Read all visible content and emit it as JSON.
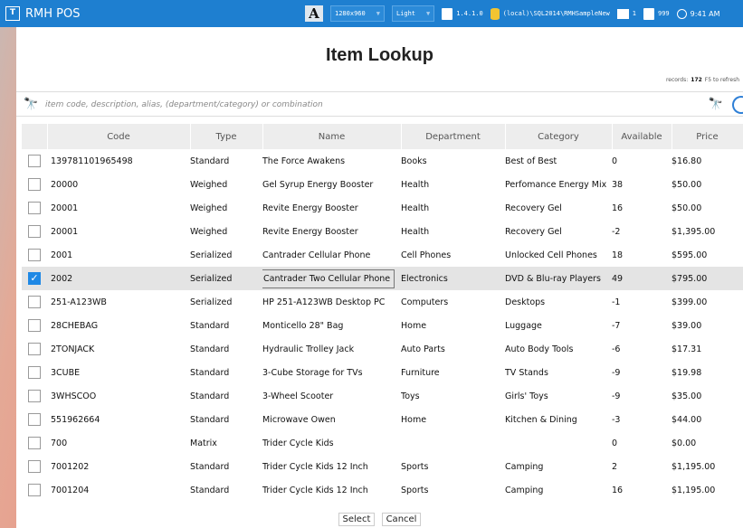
{
  "topbar": {
    "title": "RMH POS",
    "resolution": "1280x960",
    "theme": "Light",
    "version": "1.4.1.0",
    "database": "(local)\\SQL2014\\RMHSampleNew",
    "register": "1",
    "user": "999",
    "time": "9:41 AM",
    "icons": [
      "app-logo-icon",
      "font-size-icon",
      "version-icon",
      "database-icon",
      "register-icon",
      "user-icon",
      "clock-icon"
    ]
  },
  "page": {
    "title": "Item Lookup",
    "records_label": "records:",
    "records_count": "172",
    "refresh_hint": "F5 to refresh"
  },
  "search": {
    "placeholder": "item code, description, alias, (department/category) or combination",
    "value": ""
  },
  "table": {
    "columns": [
      "Code",
      "Type",
      "Name",
      "Department",
      "Category",
      "Available",
      "Price"
    ],
    "rows": [
      {
        "checked": false,
        "code": "139781101965498",
        "type": "Standard",
        "name": "The Force Awakens",
        "department": "Books",
        "category": "Best of Best",
        "available": "0",
        "price": "$16.80"
      },
      {
        "checked": false,
        "code": "20000",
        "type": "Weighed",
        "name": "Gel Syrup Energy Booster",
        "department": "Health",
        "category": "Perfomance Energy Mix",
        "available": "38",
        "price": "$50.00"
      },
      {
        "checked": false,
        "code": "20001",
        "type": "Weighed",
        "name": "Revite Energy Booster",
        "department": "Health",
        "category": "Recovery Gel",
        "available": "16",
        "price": "$50.00"
      },
      {
        "checked": false,
        "code": "20001",
        "type": "Weighed",
        "name": "Revite Energy Booster",
        "department": "Health",
        "category": "Recovery Gel",
        "available": "-2",
        "price": "$1,395.00"
      },
      {
        "checked": false,
        "code": "2001",
        "type": "Serialized",
        "name": "Cantrader Cellular Phone",
        "department": "Cell Phones",
        "category": "Unlocked Cell Phones",
        "available": "18",
        "price": "$595.00"
      },
      {
        "checked": true,
        "code": "2002",
        "type": "Serialized",
        "name": "Cantrader Two Cellular Phone",
        "department": "Electronics",
        "category": "DVD & Blu-ray Players",
        "available": "49",
        "price": "$795.00"
      },
      {
        "checked": false,
        "code": "251-A123WB",
        "type": "Serialized",
        "name": "HP 251-A123WB Desktop PC",
        "department": "Computers",
        "category": "Desktops",
        "available": "-1",
        "price": "$399.00"
      },
      {
        "checked": false,
        "code": "28CHEBAG",
        "type": "Standard",
        "name": "Monticello 28\" Bag",
        "department": "Home",
        "category": "Luggage",
        "available": "-7",
        "price": "$39.00"
      },
      {
        "checked": false,
        "code": "2TONJACK",
        "type": "Standard",
        "name": "Hydraulic Trolley Jack",
        "department": "Auto Parts",
        "category": "Auto Body Tools",
        "available": "-6",
        "price": "$17.31"
      },
      {
        "checked": false,
        "code": "3CUBE",
        "type": "Standard",
        "name": "3-Cube Storage for TVs",
        "department": "Furniture",
        "category": "TV Stands",
        "available": "-9",
        "price": "$19.98"
      },
      {
        "checked": false,
        "code": "3WHSCOO",
        "type": "Standard",
        "name": "3-Wheel Scooter",
        "department": "Toys",
        "category": "Girls' Toys",
        "available": "-9",
        "price": "$35.00"
      },
      {
        "checked": false,
        "code": "551962664",
        "type": "Standard",
        "name": "Microwave Owen",
        "department": "Home",
        "category": "Kitchen & Dining",
        "available": "-3",
        "price": "$44.00"
      },
      {
        "checked": false,
        "code": "700",
        "type": "Matrix",
        "name": "Trider Cycle Kids",
        "department": "",
        "category": "",
        "available": "0",
        "price": "$0.00"
      },
      {
        "checked": false,
        "code": "7001202",
        "type": "Standard",
        "name": "Trider Cycle Kids 12 Inch",
        "department": "Sports",
        "category": "Camping",
        "available": "2",
        "price": "$1,195.00"
      },
      {
        "checked": false,
        "code": "7001204",
        "type": "Standard",
        "name": "Trider Cycle Kids 12 Inch",
        "department": "Sports",
        "category": "Camping",
        "available": "16",
        "price": "$1,195.00"
      }
    ]
  },
  "buttons": {
    "select": "Select",
    "cancel": "Cancel"
  },
  "colors": {
    "accent": "#1e7fd0",
    "selected_row": "#e4e4e4",
    "checkbox_checked": "#1e88e5"
  }
}
